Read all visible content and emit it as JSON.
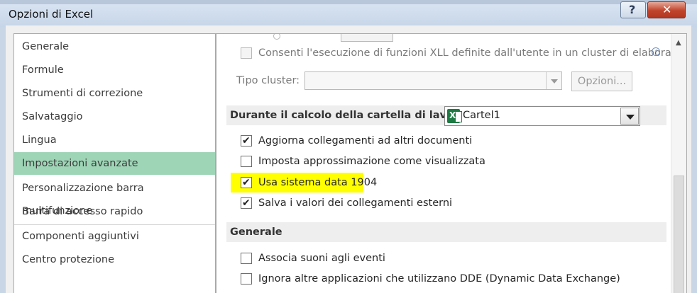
{
  "window": {
    "title": "Opzioni di Excel",
    "help_glyph": "?",
    "close_glyph": "✕"
  },
  "sidebar": {
    "items": [
      {
        "label": "Generale"
      },
      {
        "label": "Formule"
      },
      {
        "label": "Strumenti di correzione"
      },
      {
        "label": "Salvataggio"
      },
      {
        "label": "Lingua"
      },
      {
        "label": "Impostazioni avanzate",
        "selected": true
      },
      {
        "label": "Personalizzazione barra multifunzione"
      },
      {
        "label": "Barra di accesso rapido"
      },
      {
        "label": "Componenti aggiuntivi"
      },
      {
        "label": "Centro protezione"
      }
    ]
  },
  "main": {
    "xll_option": {
      "label": "Consenti l'esecuzione di funzioni XLL definite dall'utente in un cluster di elaborazione",
      "checked": false,
      "enabled": false
    },
    "cluster_type": {
      "label": "Tipo cluster:",
      "value": ""
    },
    "options_button": "Opzioni...",
    "calc_section": {
      "title": "Durante il calcolo della cartella di lavoro:",
      "workbook": "Cartel1"
    },
    "calc_options": [
      {
        "label": "Aggiorna collegamenti ad altri documenti",
        "checked": true
      },
      {
        "label": "Imposta approssimazione come visualizzata",
        "checked": false
      },
      {
        "label": "Usa sistema data 1904",
        "checked": true,
        "highlighted": true
      },
      {
        "label": "Salva i valori dei collegamenti esterni",
        "checked": true
      }
    ],
    "general_section": {
      "title": "Generale"
    },
    "general_options": [
      {
        "label": "Associa suoni agli eventi",
        "checked": false
      },
      {
        "label": "Ignora altre applicazioni che utilizzano DDE (Dynamic Data Exchange)",
        "checked": false
      }
    ]
  },
  "colors": {
    "selected_item": "#9fd5b7",
    "highlight": "#ffff00",
    "excel_green": "#1d7a43"
  }
}
